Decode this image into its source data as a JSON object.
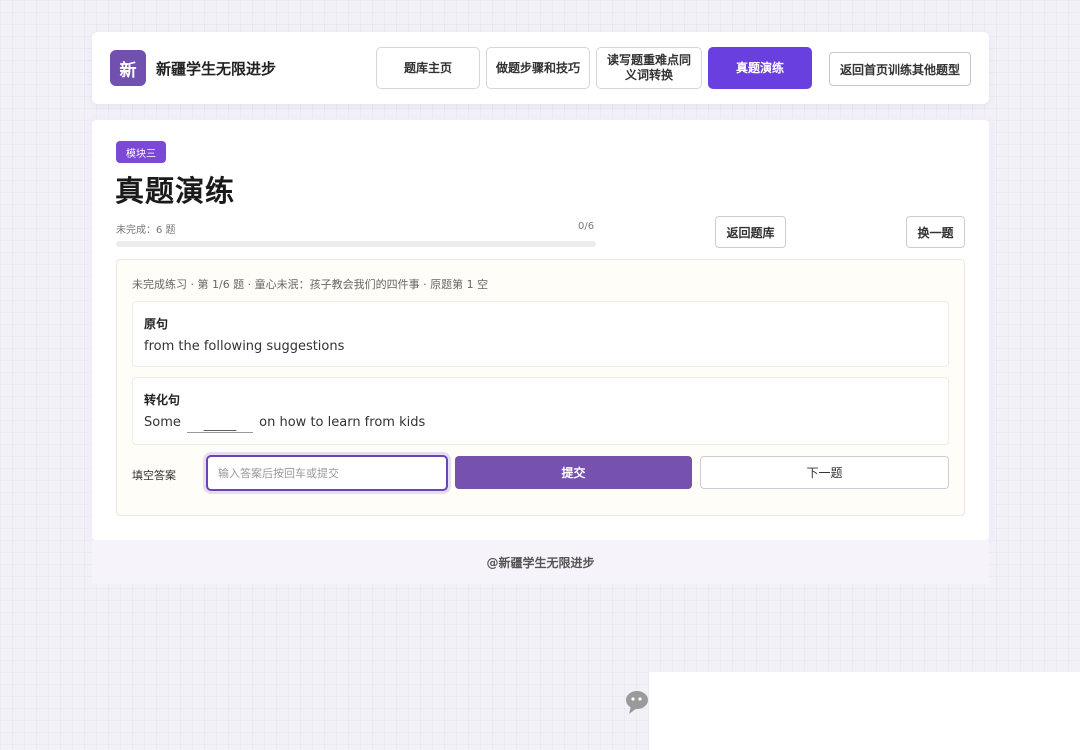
{
  "brand": {
    "logo_char": "新",
    "name": "新疆学生无限进步"
  },
  "nav": {
    "items": [
      {
        "label": "题库主页",
        "active": false
      },
      {
        "label": "做题步骤和技巧",
        "active": false
      },
      {
        "label": "读写题重难点同义词转换",
        "active": false
      },
      {
        "label": "真题演练",
        "active": true
      }
    ],
    "back_home_label": "返回首页训练其他题型"
  },
  "module": {
    "badge": "模块三",
    "title": "真题演练"
  },
  "progress": {
    "label": "未完成：6 题",
    "count": "0/6",
    "fraction": 0
  },
  "actions": {
    "back_bank": "返回题库",
    "swap": "换一题"
  },
  "practice": {
    "meta": "未完成练习 · 第 1/6 题 · 童心未泯：孩子教会我们的四件事 · 原题第 1 空",
    "original_label": "原句",
    "original_text": "from the following suggestions",
    "transformed_label": "转化句",
    "transformed_before": "Some",
    "blank": "_____",
    "transformed_after": "on how to learn from kids",
    "answer_label": "填空答案",
    "answer_placeholder": "输入答案后按回车或提交",
    "answer_value": "",
    "submit_label": "提交",
    "next_label": "下一题"
  },
  "footer": {
    "text": "@新疆学生无限进步"
  },
  "colors": {
    "accent": "#6a3fe0",
    "submit": "#7651ad",
    "badge": "#7b49d6"
  }
}
